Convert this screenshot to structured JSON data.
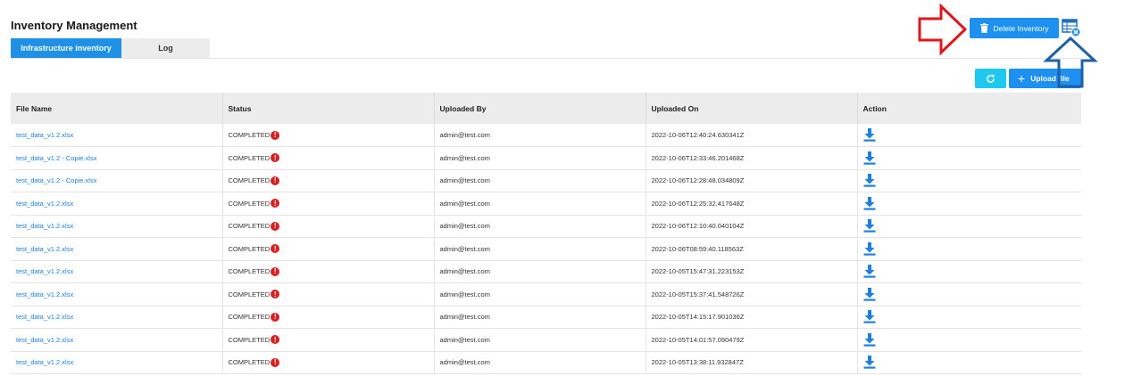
{
  "page": {
    "title": "Inventory Management"
  },
  "tabs": [
    {
      "label": "Infrastructure inventory",
      "active": true
    },
    {
      "label": "Log",
      "active": false
    }
  ],
  "toolbar": {
    "delete_label": "Delete Inventory",
    "upload_label": "Upload file",
    "refresh_icon": "refresh-icon",
    "table_icon": "table-delete-icon"
  },
  "table": {
    "columns": [
      "File Name",
      "Status",
      "Uploaded By",
      "Uploaded On",
      "Action"
    ],
    "rows": [
      {
        "file": "test_data_v1.2.xlsx",
        "status": "COMPLETED",
        "by": "admin@test.com",
        "on": "2022-10-06T12:40:24.630341Z"
      },
      {
        "file": "test_data_v1.2 - Copie.xlsx",
        "status": "COMPLETED",
        "by": "admin@test.com",
        "on": "2022-10-06T12:33:46.201468Z"
      },
      {
        "file": "test_data_v1.2 - Copie.xlsx",
        "status": "COMPLETED",
        "by": "admin@test.com",
        "on": "2022-10-06T12:28:48.034809Z"
      },
      {
        "file": "test_data_v1.2.xlsx",
        "status": "COMPLETED",
        "by": "admin@test.com",
        "on": "2022-10-06T12:25:32.417648Z"
      },
      {
        "file": "test_data_v1.2.xlsx",
        "status": "COMPLETED",
        "by": "admin@test.com",
        "on": "2022-10-06T12:10:40.040104Z"
      },
      {
        "file": "test_data_v1.2.xlsx",
        "status": "COMPLETED",
        "by": "admin@test.com",
        "on": "2022-10-06T08:59:40.118563Z"
      },
      {
        "file": "test_data_v1.2.xlsx",
        "status": "COMPLETED",
        "by": "admin@test.com",
        "on": "2022-10-05T15:47:31.223153Z"
      },
      {
        "file": "test_data_v1.2.xlsx",
        "status": "COMPLETED",
        "by": "admin@test.com",
        "on": "2022-10-05T15:37:41.548726Z"
      },
      {
        "file": "test_data_v1.2.xlsx",
        "status": "COMPLETED",
        "by": "admin@test.com",
        "on": "2022-10-05T14:15:17.901036Z"
      },
      {
        "file": "test_data_v1.2.xlsx",
        "status": "COMPLETED",
        "by": "admin@test.com",
        "on": "2022-10-05T14:01:57.090479Z"
      },
      {
        "file": "test_data_v1.2.xlsx",
        "status": "COMPLETED",
        "by": "admin@test.com",
        "on": "2022-10-05T13:38:11.932847Z"
      }
    ],
    "status_icon": "error-exclamation-icon",
    "status_icon_glyph": "!",
    "action_icon": "download-icon"
  },
  "colors": {
    "primary": "#1e90f0",
    "refresh": "#1ec8ef",
    "link": "#1e7fe0",
    "error": "#d91f1f",
    "annotation_red": "#e0161b",
    "annotation_blue": "#1d5fa8"
  }
}
